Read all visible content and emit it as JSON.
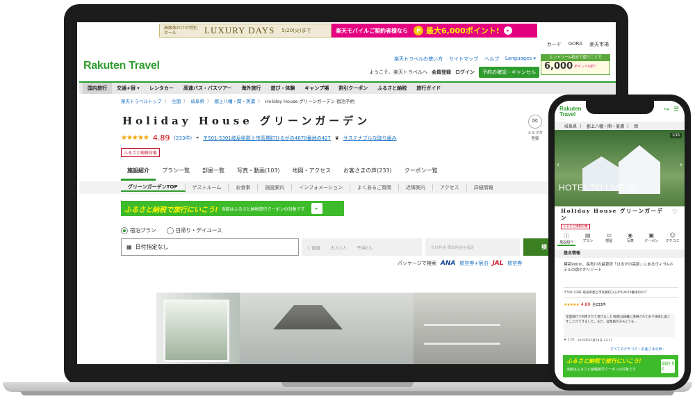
{
  "banner": {
    "small_text": "高級宿だけの特別セール",
    "title": "LUXURY DAYS",
    "date": "5/20(火)まで",
    "right_text": "楽天モバイルご契約者様なら",
    "coin": "P",
    "points": "最大6,000ポイント!",
    "arrow": "▸"
  },
  "toplinks": [
    "カード",
    "GORA",
    "楽天市場"
  ],
  "logo": "Rakuten Travel",
  "utility": {
    "links": [
      "楽天トラベルの使い方",
      "サイトマップ",
      "ヘルプ",
      "Languages ▾"
    ],
    "welcome": "ようこそ、楽天トラベルへ",
    "register": "会員登録",
    "login": "ログイン",
    "confirm": "予約の確認・キャンセル"
  },
  "promo": {
    "head": "エントリー&初めて使うことで",
    "points": "6,000",
    "unit": "ポイントGET!"
  },
  "nav": [
    "国内旅行",
    "交通+宿 ▾",
    "レンタカー",
    "高速バス・バスツアー",
    "海外旅行",
    "遊び・体験",
    "キャンプ場",
    "割引クーポン",
    "ふるさと納税",
    "旅行ガイド"
  ],
  "breadcrumb": [
    "楽天トラベルトップ",
    "全国",
    "岐阜県",
    "郡上八幡・関・美濃"
  ],
  "breadcrumb_current": "Holiday House グリーンガーデン 宿泊予約",
  "breadcrumb_sep": "〉",
  "hotel": {
    "name": "Holiday House グリーンガーデン",
    "stars": "★★★★★",
    "score": "4.89",
    "count": "(233件)",
    "address": "〒501-5301岐阜県郡上市高鷲町ひるがの4670番地の427",
    "sustainable": "サステナブルな取り組み",
    "tag": "ふるさと納税対象"
  },
  "mailmag": {
    "icon": "✉",
    "label": "メルマガ登録"
  },
  "tabs": [
    "施設紹介",
    "プラン一覧",
    "部屋一覧",
    "写真・動画(103)",
    "地図・アクセス",
    "お客さまの声(233)",
    "クーポン一覧"
  ],
  "subtabs": [
    "グリーンガーデンTOP",
    "ゲストルーム",
    "お食事",
    "施設案内",
    "インフォメーション",
    "よくあるご質問",
    "近隣案内",
    "アクセス",
    "詳細情報"
  ],
  "furusato_banner": {
    "title": "ふるさと納税で旅行にいこう!",
    "text": "当館はふるさと納税旅行クーポンの対象です",
    "btn": "▸"
  },
  "search": {
    "radio1": "宿泊プラン",
    "radio2": "日帰り・デイユース",
    "date_icon": "▦",
    "date": "日付指定なし",
    "rooms": "1 部屋",
    "adults": "大人1人",
    "children": "子供0人",
    "price": "合計料金 宿泊料金を指定",
    "button": "検"
  },
  "package": {
    "label": "パッケージで検索",
    "ana": "ANA",
    "ana_text": "航空券+宿泊",
    "jal": "JAL",
    "jal_text": "航空券"
  },
  "phone": {
    "logo1": "Rakuten",
    "logo2": "Travel",
    "icons": [
      "↪",
      "☰"
    ],
    "breadcrumb": [
      "岐阜県",
      "郡上八幡・関・美濃",
      "岡"
    ],
    "photo_text": "HOTEL TO LIVE IN",
    "counter": "1/16",
    "arrow_l": "‹",
    "arrow_r": "›",
    "title": "Holiday House グリーンガーデン",
    "heart": "♡",
    "tag": "ふるさと納税対象",
    "tabs": [
      {
        "icon": "ⓘ",
        "label": "施設紹介"
      },
      {
        "icon": "▤",
        "label": "プラン"
      },
      {
        "icon": "▭",
        "label": "部屋"
      },
      {
        "icon": "◉",
        "label": "写真"
      },
      {
        "icon": "▣",
        "label": "クーポン"
      },
      {
        "icon": "☺",
        "label": "クチコミ"
      }
    ],
    "section": "基本情報",
    "desc": "標高900m、長良川の最源流「ひるがの高原」にあるヴィラ&ホテルの宿やかリゾート",
    "address": "〒501-5301 岐阜県郡上市高鷲町ひるがの4670番地の427",
    "stars": "★★★★★",
    "score": "4.89",
    "count": "全233件",
    "review": "卒業旅行で利用させて頂きました!部屋は綺麗に清掃されており快適に過ごすことができました。また、従業員の方もとても…",
    "review_score": "★ 5.00",
    "review_date": "2025年02月28日 13:17",
    "all_link": "すべてのクチコミ・お客さまの声 ›",
    "fb_title": "ふるさと納税で旅行にいこう!",
    "fb_text": "当館はふるさと納税旅行クーポンの対象です",
    "fb_btn": "詳細を見る"
  }
}
